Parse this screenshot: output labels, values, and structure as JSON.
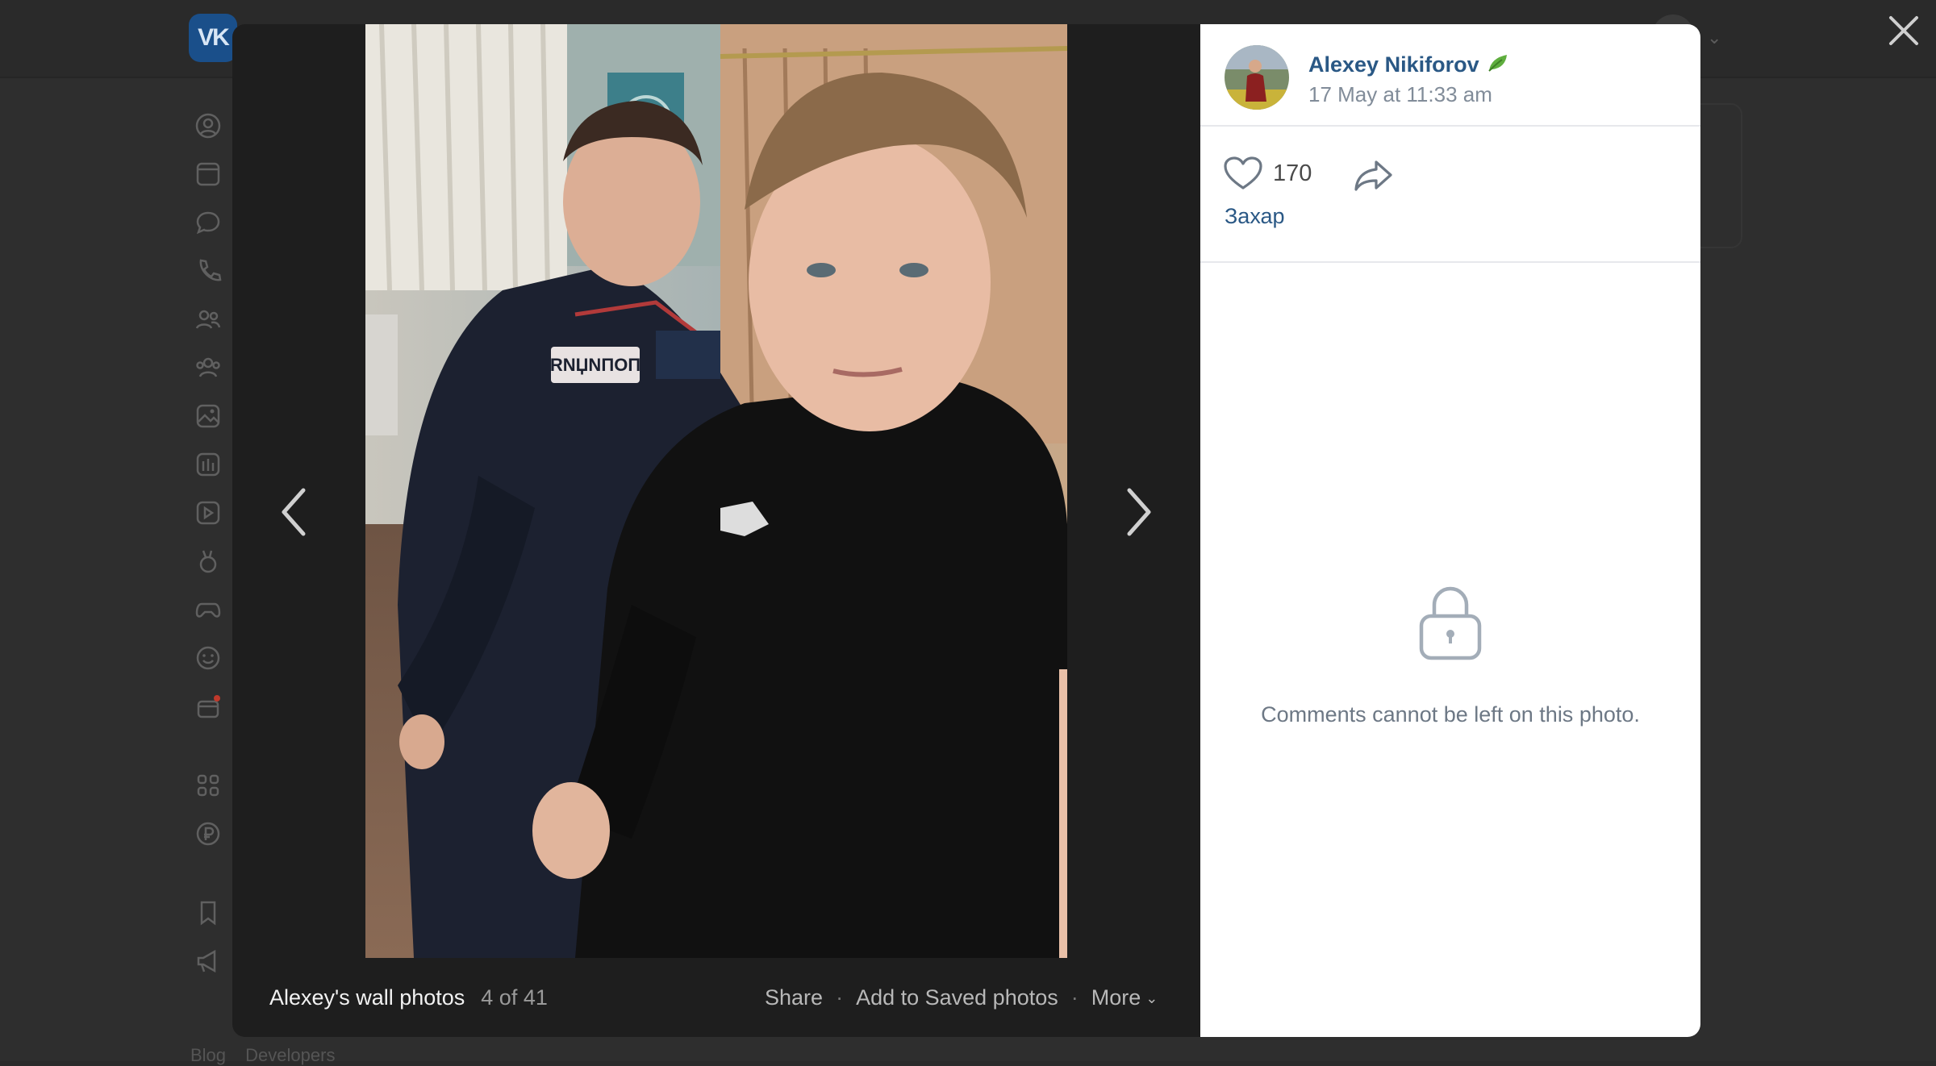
{
  "app": {
    "logo_text": "VK"
  },
  "viewer": {
    "album_title": "Alexey's wall photos",
    "position": "4 of 41",
    "actions": {
      "share": "Share",
      "save": "Add to Saved photos",
      "more": "More"
    },
    "separator": "·"
  },
  "post": {
    "author_name": "Alexey Nikiforov",
    "author_badge_icon": "leaf-icon",
    "date": "17 May at 11:33 am",
    "likes_count": "170",
    "liker_name": "Захар",
    "comments_closed_text": "Comments cannot be left on this photo."
  },
  "background_footer": {
    "links": [
      "Blog",
      "Developers"
    ]
  },
  "colors": {
    "link_blue": "#2a5885",
    "muted_gray": "#818c99",
    "overlay_dark": "#1e1e1e",
    "panel_white": "#ffffff"
  },
  "icons": [
    "profile-icon",
    "news-icon",
    "messages-icon",
    "calls-icon",
    "friends-icon",
    "communities-icon",
    "photos-icon",
    "music-icon",
    "video-icon",
    "clips-icon",
    "games-icon",
    "stickers-icon",
    "gifts-icon",
    "services-icon",
    "payments-icon",
    "bookmarks-icon",
    "ads-icon"
  ]
}
